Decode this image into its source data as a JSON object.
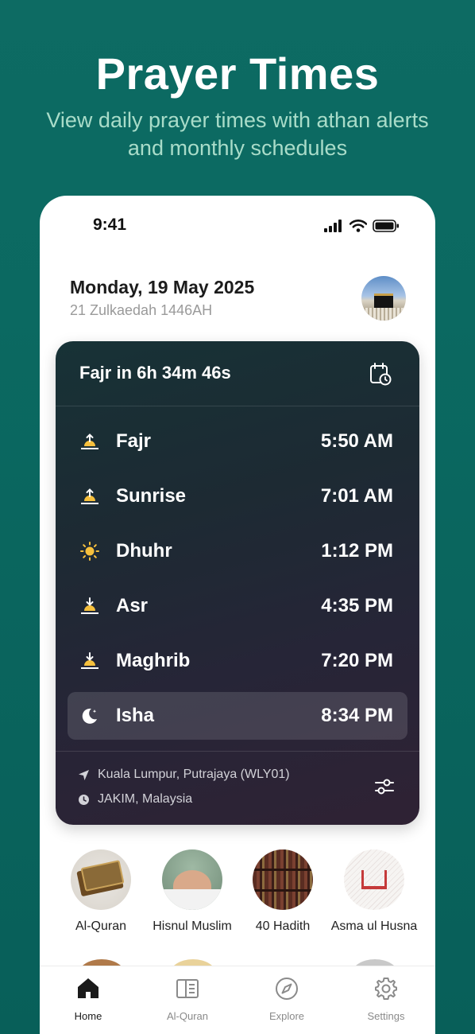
{
  "hero": {
    "title": "Prayer Times",
    "subtitle": "View daily prayer times with athan alerts and monthly schedules"
  },
  "status_bar": {
    "time": "9:41"
  },
  "header": {
    "date": "Monday, 19 May 2025",
    "hijri": "21 Zulkaedah 1446AH"
  },
  "prayer_card": {
    "countdown": "Fajr in 6h 34m 46s",
    "prayers": [
      {
        "name": "Fajr",
        "time": "5:50 AM",
        "icon": "sunrise-up-icon"
      },
      {
        "name": "Sunrise",
        "time": "7:01 AM",
        "icon": "sunrise-up-icon"
      },
      {
        "name": "Dhuhr",
        "time": "1:12 PM",
        "icon": "sun-icon"
      },
      {
        "name": "Asr",
        "time": "4:35 PM",
        "icon": "sunset-down-icon"
      },
      {
        "name": "Maghrib",
        "time": "7:20 PM",
        "icon": "sunset-down-icon"
      },
      {
        "name": "Isha",
        "time": "8:34 PM",
        "icon": "moon-icon"
      }
    ],
    "active_prayer": "Isha",
    "location": "Kuala Lumpur, Putrajaya (WLY01)",
    "method": "JAKIM, Malaysia"
  },
  "shortcuts": [
    {
      "label": "Al-Quran"
    },
    {
      "label": "Hisnul Muslim"
    },
    {
      "label": "40 Hadith"
    },
    {
      "label": "Asma ul Husna"
    }
  ],
  "tabs": [
    {
      "label": "Home",
      "icon": "home-icon",
      "active": true
    },
    {
      "label": "Al-Quran",
      "icon": "book-icon",
      "active": false
    },
    {
      "label": "Explore",
      "icon": "compass-icon",
      "active": false
    },
    {
      "label": "Settings",
      "icon": "gear-icon",
      "active": false
    }
  ],
  "colors": {
    "background": "#0f6a62",
    "subtitle": "#a9dcc9",
    "icon_yellow": "#f6c03d"
  }
}
